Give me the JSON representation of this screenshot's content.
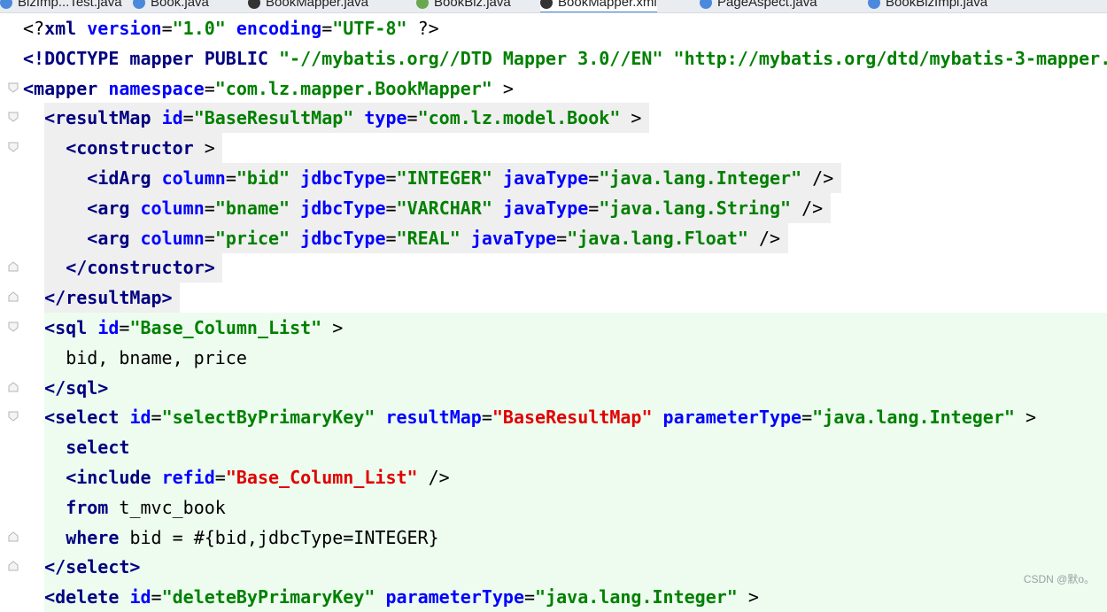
{
  "tabs": [
    {
      "label": "BizImp...Test.java",
      "icon": "java-class-icon",
      "active": false
    },
    {
      "label": "Book.java",
      "icon": "java-class-icon",
      "active": false
    },
    {
      "label": "BookMapper.java",
      "icon": "mapper-interface-icon",
      "active": false
    },
    {
      "label": "BookBiz.java",
      "icon": "java-interface-icon",
      "active": false
    },
    {
      "label": "BookMapper.xml",
      "icon": "mybatis-xml-icon",
      "active": true
    },
    {
      "label": "PageAspect.java",
      "icon": "java-class-icon",
      "active": false
    },
    {
      "label": "BookBizImpl.java",
      "icon": "java-class-icon",
      "active": false
    }
  ],
  "colors": {
    "tag": "#000080",
    "attribute": "#0000ff",
    "value": "#008000",
    "reference_value": "#e00000",
    "block_highlight": "#efefef",
    "sql_highlight": "#edfcef"
  },
  "editor": {
    "lines": [
      {
        "tokens": [
          [
            "p",
            "<?"
          ],
          [
            "t",
            "xml"
          ],
          [
            "p",
            " "
          ],
          [
            "a",
            "version"
          ],
          [
            "p",
            "="
          ],
          [
            "v",
            "\"1.0\""
          ],
          [
            "p",
            " "
          ],
          [
            "a",
            "encoding"
          ],
          [
            "p",
            "="
          ],
          [
            "v",
            "\"UTF-8\""
          ],
          [
            "p",
            " ?>"
          ]
        ]
      },
      {
        "tokens": [
          [
            "t",
            "<!DOCTYPE"
          ],
          [
            "p",
            " "
          ],
          [
            "t",
            "mapper"
          ],
          [
            "p",
            " "
          ],
          [
            "t",
            "PUBLIC"
          ],
          [
            "p",
            " "
          ],
          [
            "v",
            "\"-//mybatis.org//DTD Mapper 3.0//EN\""
          ],
          [
            "p",
            " "
          ],
          [
            "v",
            "\"http://mybatis.org/dtd/mybatis-3-mapper."
          ]
        ]
      },
      {
        "tokens": [
          [
            "t",
            "<mapper"
          ],
          [
            "p",
            " "
          ],
          [
            "a",
            "namespace"
          ],
          [
            "p",
            "="
          ],
          [
            "v",
            "\"com.lz.mapper.BookMapper\""
          ],
          [
            "p",
            " >"
          ]
        ]
      },
      {
        "tokens": [
          [
            "t",
            "<resultMap"
          ],
          [
            "p",
            " "
          ],
          [
            "a",
            "id"
          ],
          [
            "p",
            "="
          ],
          [
            "v",
            "\"BaseResultMap\""
          ],
          [
            "p",
            " "
          ],
          [
            "a",
            "type"
          ],
          [
            "p",
            "="
          ],
          [
            "v",
            "\"com.lz.model.Book\""
          ],
          [
            "p",
            " >"
          ]
        ]
      },
      {
        "tokens": [
          [
            "t",
            "<constructor"
          ],
          [
            "p",
            " >"
          ]
        ]
      },
      {
        "tokens": [
          [
            "t",
            "<idArg"
          ],
          [
            "p",
            " "
          ],
          [
            "a",
            "column"
          ],
          [
            "p",
            "="
          ],
          [
            "v",
            "\"bid\""
          ],
          [
            "p",
            " "
          ],
          [
            "a",
            "jdbcType"
          ],
          [
            "p",
            "="
          ],
          [
            "v",
            "\"INTEGER\""
          ],
          [
            "p",
            " "
          ],
          [
            "a",
            "javaType"
          ],
          [
            "p",
            "="
          ],
          [
            "v",
            "\"java.lang.Integer\""
          ],
          [
            "p",
            " />"
          ]
        ]
      },
      {
        "tokens": [
          [
            "t",
            "<arg"
          ],
          [
            "p",
            " "
          ],
          [
            "a",
            "column"
          ],
          [
            "p",
            "="
          ],
          [
            "v",
            "\"bname\""
          ],
          [
            "p",
            " "
          ],
          [
            "a",
            "jdbcType"
          ],
          [
            "p",
            "="
          ],
          [
            "v",
            "\"VARCHAR\""
          ],
          [
            "p",
            " "
          ],
          [
            "a",
            "javaType"
          ],
          [
            "p",
            "="
          ],
          [
            "v",
            "\"java.lang.String\""
          ],
          [
            "p",
            " />"
          ]
        ]
      },
      {
        "tokens": [
          [
            "t",
            "<arg"
          ],
          [
            "p",
            " "
          ],
          [
            "a",
            "column"
          ],
          [
            "p",
            "="
          ],
          [
            "v",
            "\"price\""
          ],
          [
            "p",
            " "
          ],
          [
            "a",
            "jdbcType"
          ],
          [
            "p",
            "="
          ],
          [
            "v",
            "\"REAL\""
          ],
          [
            "p",
            " "
          ],
          [
            "a",
            "javaType"
          ],
          [
            "p",
            "="
          ],
          [
            "v",
            "\"java.lang.Float\""
          ],
          [
            "p",
            " />"
          ]
        ]
      },
      {
        "tokens": [
          [
            "t",
            "</constructor>"
          ]
        ]
      },
      {
        "tokens": [
          [
            "t",
            "</resultMap>"
          ]
        ]
      },
      {
        "tokens": [
          [
            "t",
            "<sql"
          ],
          [
            "p",
            " "
          ],
          [
            "a",
            "id"
          ],
          [
            "p",
            "="
          ],
          [
            "v",
            "\"Base_Column_List\""
          ],
          [
            "p",
            " >"
          ]
        ]
      },
      {
        "tokens": [
          [
            "p",
            "bid, bname, price"
          ]
        ]
      },
      {
        "tokens": [
          [
            "t",
            "</sql>"
          ]
        ]
      },
      {
        "tokens": [
          [
            "t",
            "<select"
          ],
          [
            "p",
            " "
          ],
          [
            "a",
            "id"
          ],
          [
            "p",
            "="
          ],
          [
            "v",
            "\"selectByPrimaryKey\""
          ],
          [
            "p",
            " "
          ],
          [
            "a",
            "resultMap"
          ],
          [
            "p",
            "="
          ],
          [
            "r",
            "\"BaseResultMap\""
          ],
          [
            "p",
            " "
          ],
          [
            "a",
            "parameterType"
          ],
          [
            "p",
            "="
          ],
          [
            "v",
            "\"java.lang.Integer\""
          ],
          [
            "p",
            " >"
          ]
        ]
      },
      {
        "tokens": [
          [
            "k",
            "select"
          ]
        ]
      },
      {
        "tokens": [
          [
            "t",
            "<include"
          ],
          [
            "p",
            " "
          ],
          [
            "a",
            "refid"
          ],
          [
            "p",
            "="
          ],
          [
            "r",
            "\"Base_Column_List\""
          ],
          [
            "p",
            " />"
          ]
        ]
      },
      {
        "tokens": [
          [
            "k",
            "from"
          ],
          [
            "p",
            " t_mvc_book"
          ]
        ]
      },
      {
        "tokens": [
          [
            "k",
            "where"
          ],
          [
            "p",
            " bid = #{bid,jdbcType=INTEGER}"
          ]
        ]
      },
      {
        "tokens": [
          [
            "t",
            "</select>"
          ]
        ]
      },
      {
        "tokens": [
          [
            "t",
            "<delete"
          ],
          [
            "p",
            " "
          ],
          [
            "a",
            "id"
          ],
          [
            "p",
            "="
          ],
          [
            "v",
            "\"deleteByPrimaryKey\""
          ],
          [
            "p",
            " "
          ],
          [
            "a",
            "parameterType"
          ],
          [
            "p",
            "="
          ],
          [
            "v",
            "\"java.lang.Integer\""
          ],
          [
            "p",
            " >"
          ]
        ]
      }
    ]
  },
  "watermark": "CSDN @默o。"
}
